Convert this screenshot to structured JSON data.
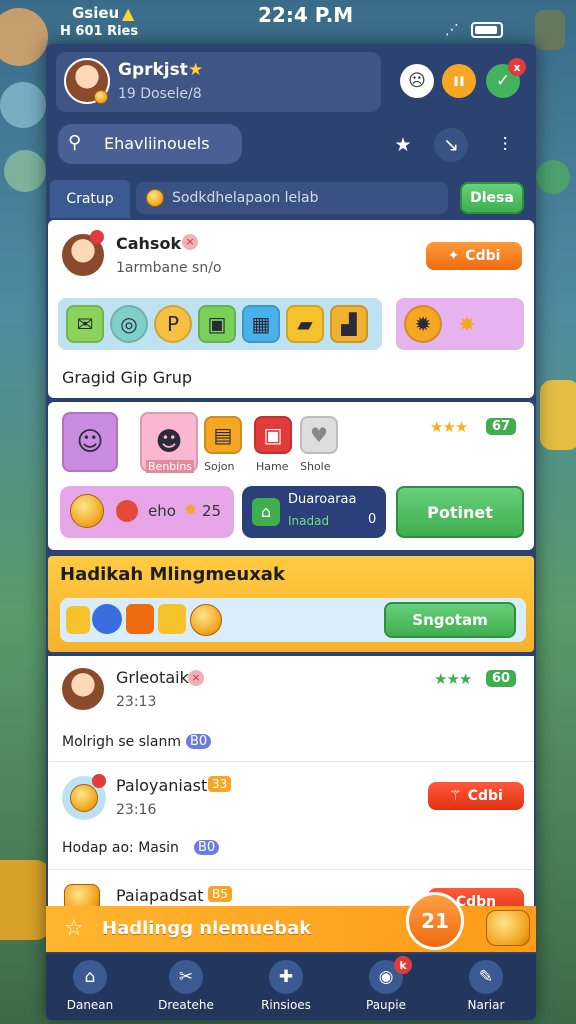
{
  "status_bar": {
    "carrier_top": "Gsieu",
    "carrier_bottom": "H 601 Ries",
    "time": "22:4 P.M",
    "wifi_icon": "wifi-icon",
    "battery_icon": "battery-icon"
  },
  "profile": {
    "name": "Gprkjst",
    "subtitle": "19 Dosele/8"
  },
  "header_buttons": {
    "reaction_icon": "face-icon",
    "pause_icon": "pause-icon",
    "chat_icon": "chat-icon",
    "badge": "x"
  },
  "search": {
    "placeholder": "Ehavliinouels"
  },
  "toolbar_icons": {
    "star": "star-icon",
    "tool": "wrench-icon",
    "more": "dots-icon"
  },
  "tabs": {
    "active": "Cratup",
    "info": "Sodkdhelapaon lelab",
    "action": "Dlesa"
  },
  "card1": {
    "name": "Cahsok",
    "subtitle": "1armbane sn/o",
    "button": "Cdbi",
    "footer": "Gragid Gip Grup"
  },
  "card2": {
    "stars": "★★★",
    "score": "67",
    "labels": [
      "Benbins",
      "Sojon",
      "Hame",
      "Shole"
    ],
    "coins_value": "eho",
    "coins_count": "25",
    "panel_title": "Duaroaraa",
    "panel_sub": "Inadad",
    "panel_value": "0",
    "button": "Potinet"
  },
  "banner": {
    "title": "Hadikah Mlingmeuxak",
    "button": "Sngotam"
  },
  "list": [
    {
      "name": "Grleotaik",
      "time": "23:13",
      "desc": "Molrigh se slanm",
      "stars": "★★★",
      "score": "60",
      "badge": "B0"
    },
    {
      "name": "Paloyaniast",
      "time": "23:16",
      "desc": "Hodap ao: Masin",
      "button": "Cdbi",
      "badge": "33",
      "level": "B0"
    },
    {
      "name": "Paiapadsat",
      "badge": "B5",
      "button": "Cdbn"
    }
  ],
  "footer_banner": {
    "title": "Hadlingg nlemuebak",
    "badge": "21"
  },
  "nav": [
    {
      "label": "Danean",
      "icon": "home-icon"
    },
    {
      "label": "Dreatehe",
      "icon": "tools-icon"
    },
    {
      "label": "Rinsioes",
      "icon": "add-icon"
    },
    {
      "label": "Paupie",
      "icon": "controller-icon",
      "badge": "k"
    },
    {
      "label": "Nariar",
      "icon": "pen-icon"
    }
  ],
  "colors": {
    "accent": "#2c4270",
    "gold": "#ffcb42",
    "green": "#3fae4f",
    "orange": "#f06a10"
  }
}
